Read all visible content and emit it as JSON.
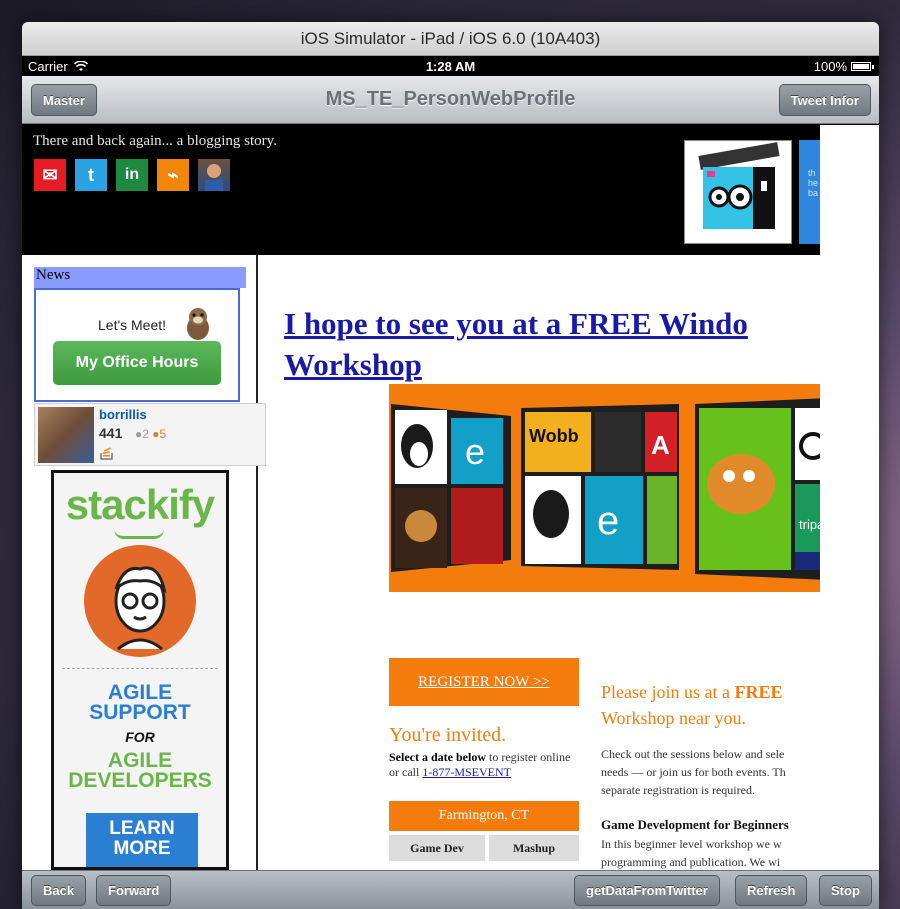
{
  "simulator": {
    "title": "iOS Simulator - iPad / iOS 6.0 (10A403)"
  },
  "status_bar": {
    "carrier": "Carrier",
    "time": "1:28 AM",
    "battery": "100%"
  },
  "navbar": {
    "left_button": "Master",
    "title": "MS_TE_PersonWebProfile",
    "right_button": "Tweet Infor"
  },
  "blog": {
    "tagline": "There and back again... a blogging story.",
    "social": [
      {
        "icon": "email-icon",
        "glyph": "✉"
      },
      {
        "icon": "twitter-icon",
        "glyph": "t"
      },
      {
        "icon": "linkedin-icon",
        "glyph": "in"
      },
      {
        "icon": "rss-icon",
        "glyph": "⌁"
      }
    ],
    "generation_side_text": "th he ba"
  },
  "sidebar": {
    "news_heading": "News",
    "office_hours": {
      "lets_meet": "Let's Meet!",
      "button": "My Office Hours"
    },
    "stackoverflow": {
      "user": "borrillis",
      "reputation": "441",
      "silver_badges": "●2",
      "bronze_badges": "●5"
    },
    "ad": {
      "logo": "stackify",
      "line1": "AGILE\nSUPPORT",
      "line2": "FOR",
      "line3": "AGILE\nDEVELOPERS",
      "button": "LEARN\nMORE"
    }
  },
  "post": {
    "title_line1": "I hope to see you at a FREE Windo",
    "title_line2": "Workshop",
    "register_button": "REGISTER NOW >>",
    "invited": "You're invited.",
    "select_bold": "Select a date below",
    "select_rest": " to register online or call ",
    "phone_link": "1-877-MSEVENT",
    "city": "Farmington, CT",
    "table_headers": [
      "Game Dev",
      "Mashup"
    ],
    "join_prefix": "Please join us at a ",
    "join_bold": "FREE",
    "join_line2": "Workshop near you.",
    "check_line1": "Check out the sessions below and sele",
    "check_line2": "needs — or join us for both events. Th",
    "check_line3": "separate registration is required.",
    "game_heading": "Game Development for Beginners",
    "game_line1": "In this beginner level workshop we w",
    "game_line2": "programming and publication. We wi"
  },
  "toolbar": {
    "back": "Back",
    "forward": "Forward",
    "get_data": "getDataFromTwitter",
    "refresh": "Refresh",
    "stop": "Stop"
  },
  "colors": {
    "accent_orange": "#f47c0c",
    "link_blue": "#1a1aa8",
    "news_bar": "#8b9cff"
  }
}
